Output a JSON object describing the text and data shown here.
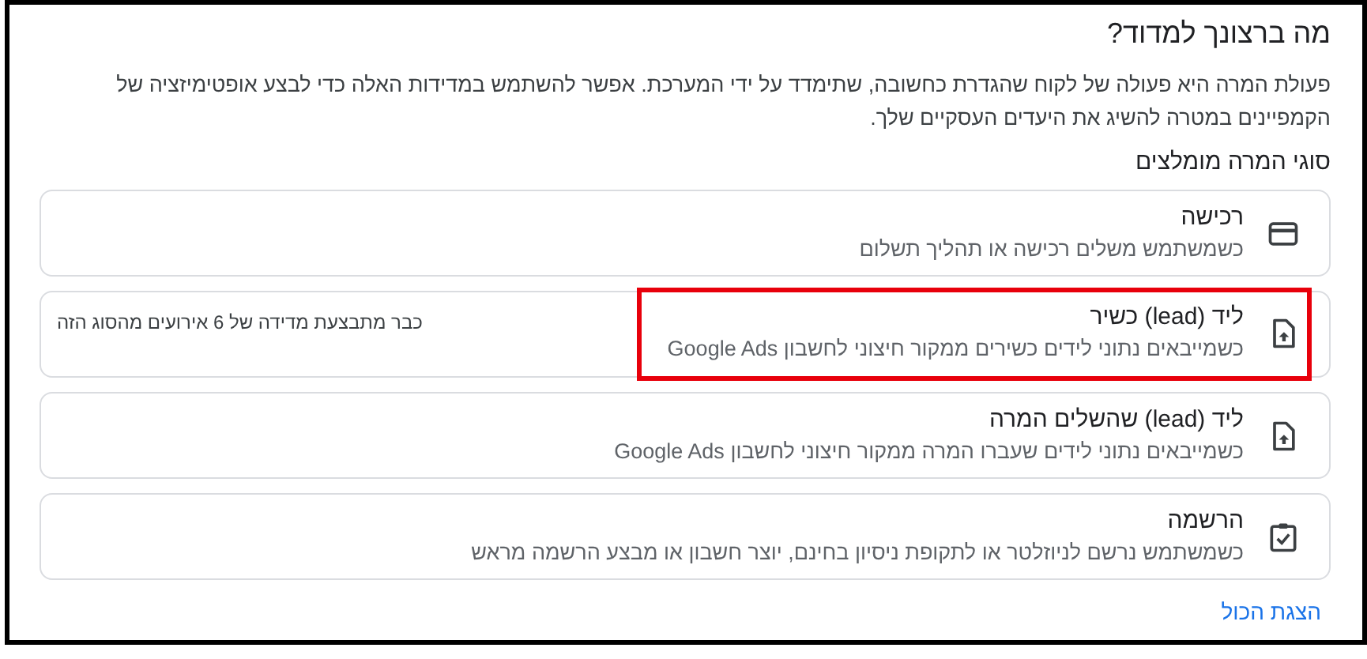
{
  "title": "מה ברצונך למדוד?",
  "description": "פעולת המרה היא פעולה של לקוח שהגדרת כחשובה, שתימדד על ידי המערכת. אפשר להשתמש במדידות האלה כדי לבצע אופטימיזציה של הקמפיינים במטרה להשיג את היעדים העסקיים שלך.",
  "section_title": "סוגי המרה מומלצים",
  "options": [
    {
      "kind": "card",
      "title": "רכישה",
      "subtitle": "כשמשתמש משלים רכישה או תהליך תשלום",
      "highlighted": false
    },
    {
      "kind": "upload",
      "title": "ליד (lead) כשיר",
      "subtitle": "כשמייבאים נתוני לידים כשירים ממקור חיצוני לחשבון Google Ads",
      "note": "כבר מתבצעת מדידה של 6 אירועים מהסוג הזה",
      "highlighted": true
    },
    {
      "kind": "upload",
      "title": "ליד (lead) שהשלים המרה",
      "subtitle": "כשמייבאים נתוני לידים שעברו המרה ממקור חיצוני לחשבון Google Ads",
      "highlighted": false
    },
    {
      "kind": "clipboard",
      "title": "הרשמה",
      "subtitle": "כשמשתמש נרשם לניוזלטר או לתקופת ניסיון בחינם, יוצר חשבון או מבצע הרשמה מראש",
      "highlighted": false
    }
  ],
  "show_all_link": "הצגת הכול"
}
